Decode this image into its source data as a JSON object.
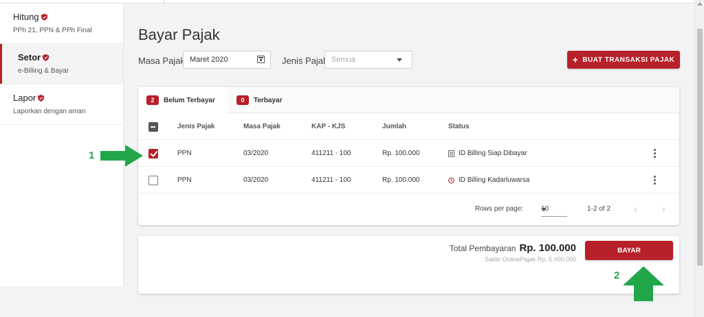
{
  "sidebar": {
    "items": [
      {
        "title": "Hitung",
        "subtitle": "PPh 21, PPN & PPh Final"
      },
      {
        "title": "Setor",
        "subtitle": "e-Billing & Bayar"
      },
      {
        "title": "Lapor",
        "subtitle": "Laporkan dengan aman"
      }
    ]
  },
  "page": {
    "title": "Bayar Pajak"
  },
  "filters": {
    "masa_label": "Masa Pajak",
    "masa_value": "Maret 2020",
    "jenis_label": "Jenis Pajak",
    "jenis_placeholder": "Semua"
  },
  "actions": {
    "new_transaction": "BUAT TRANSAKSI PAJAK",
    "new_transaction_icon": "plus-icon"
  },
  "tabs": [
    {
      "count": "2",
      "label": "Belum Terbayar"
    },
    {
      "count": "0",
      "label": "Terbayar"
    }
  ],
  "table": {
    "headers": [
      "Jenis Pajak",
      "Masa Pajak",
      "KAP - KJS",
      "Jumlah",
      "Status"
    ],
    "rows": [
      {
        "jenis": "PPN",
        "masa": "03/2020",
        "kap": "411211 - 100",
        "jumlah": "Rp. 100.000",
        "status": "ID Billing Siap Dibayar",
        "status_icon": "document-icon",
        "checked": true
      },
      {
        "jenis": "PPN",
        "masa": "03/2020",
        "kap": "411211 - 100",
        "jumlah": "Rp. 100.000",
        "status": "ID Billing Kadarluwarsa",
        "status_icon": "clock-icon",
        "checked": false
      }
    ]
  },
  "pagination": {
    "rows_label": "Rows per page:",
    "rows_value": "10",
    "range": "1-2 of 2"
  },
  "summary": {
    "total_label": "Total Pembayaran",
    "total_value": "Rp. 100.000",
    "saldo": "Saldo OnlinePajak Rp. 5.000.000",
    "pay_label": "BAYAR"
  },
  "annotations": [
    {
      "number": "1"
    },
    {
      "number": "2"
    }
  ],
  "colors": {
    "accent": "#b8202a",
    "annotation": "#22a64a"
  }
}
